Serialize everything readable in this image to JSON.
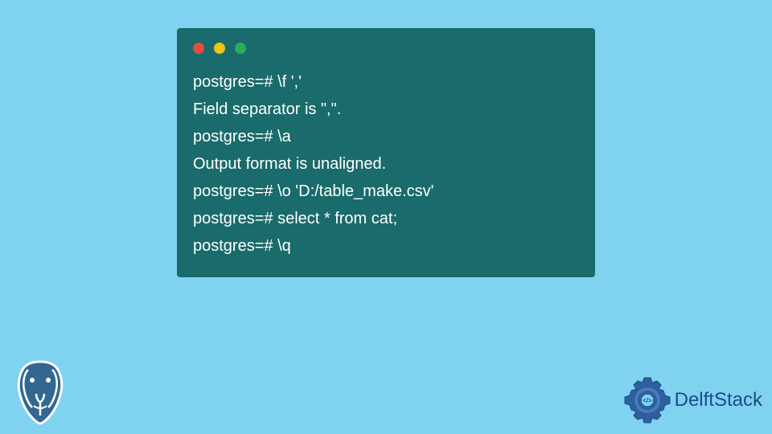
{
  "terminal": {
    "lines": [
      "postgres=# \\f ','",
      "Field separator is \",\".",
      "postgres=# \\a",
      "Output format is unaligned.",
      "postgres=# \\o 'D:/table_make.csv'",
      "postgres=# select * from cat;",
      "postgres=# \\q"
    ]
  },
  "branding": {
    "delftstack_label": "DelftStack"
  },
  "colors": {
    "background": "#7fd3f0",
    "terminal_bg": "#1a6b6b",
    "terminal_text": "#ffffff",
    "dot_red": "#e74c3c",
    "dot_yellow": "#f1c40f",
    "dot_green": "#27ae60",
    "brand_blue": "#1e4a8c"
  }
}
